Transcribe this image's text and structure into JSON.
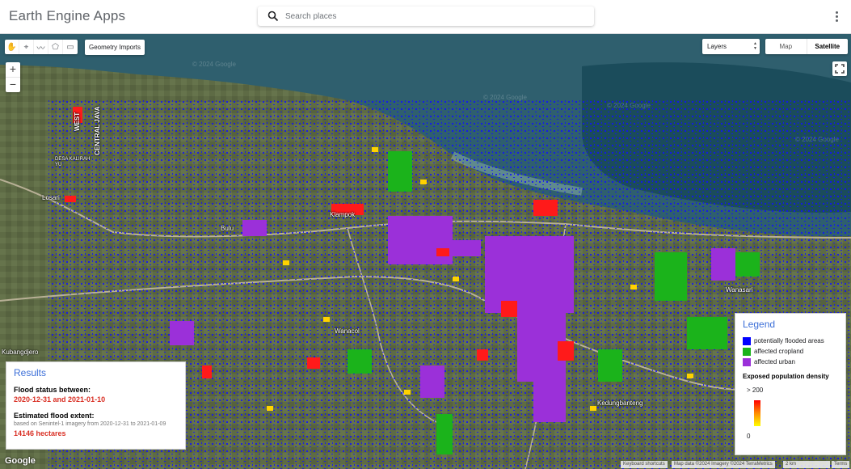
{
  "app": {
    "title": "Earth Engine Apps",
    "menu_icon": "more-vert-icon"
  },
  "search": {
    "placeholder": "Search places",
    "icon": "search-icon"
  },
  "toolbar": {
    "tools": [
      {
        "name": "pan-hand-icon",
        "glyph": "✋"
      },
      {
        "name": "point-marker-icon",
        "glyph": "⌖"
      },
      {
        "name": "line-icon",
        "glyph": "〰"
      },
      {
        "name": "polygon-icon",
        "glyph": "⬠"
      },
      {
        "name": "rectangle-icon",
        "glyph": "▭"
      }
    ],
    "geometry_imports_label": "Geometry Imports"
  },
  "zoom": {
    "in_label": "+",
    "out_label": "−"
  },
  "layers": {
    "label": "Layers"
  },
  "map_type": {
    "map_label": "Map",
    "satellite_label": "Satellite",
    "selected": "Satellite"
  },
  "places": [
    {
      "name": "place-label-desa-kalirahyu",
      "text": "DESA KALIRAH YU"
    },
    {
      "name": "place-label-losari",
      "text": "Losari"
    },
    {
      "name": "place-label-bulu",
      "text": "Bulu"
    },
    {
      "name": "place-label-klampok",
      "text": "Klampok"
    },
    {
      "name": "place-label-wanasari",
      "text": "Wanasari"
    },
    {
      "name": "place-label-wanacol",
      "text": "Wanacol"
    },
    {
      "name": "place-label-kubangdjero",
      "text": "Kubangdjero"
    },
    {
      "name": "place-label-kedungbanteng",
      "text": "Kedungbanteng"
    },
    {
      "name": "place-label-west",
      "text": "WEST"
    },
    {
      "name": "place-label-central-java",
      "text": "CENTRAL JAVA"
    }
  ],
  "watermark": "© 2024 Google",
  "results": {
    "title": "Results",
    "status_label": "Flood status between:",
    "status_range": "2020-12-31 and 2021-01-10",
    "extent_label": "Estimated flood extent:",
    "extent_note": "based on Senintel-1 imagery from 2020-12-31 to 2021-01-09",
    "extent_value": "14146 hectares"
  },
  "legend": {
    "title": "Legend",
    "items": [
      {
        "label": "potentially flooded areas",
        "color": "#0000ff"
      },
      {
        "label": "affected cropland",
        "color": "#1bb31b"
      },
      {
        "label": "affected urban",
        "color": "#9b30d9"
      }
    ],
    "population_title": "Exposed population density",
    "population_max": "> 200",
    "population_min": "0",
    "population_colors": [
      "#ff0000",
      "#ff8c00",
      "#ffff00"
    ]
  },
  "footer": {
    "google_logo": "Google",
    "keyboard_shortcuts": "Keyboard shortcuts",
    "map_data": "Map data ©2024 Imagery ©2024 TerraMetrics",
    "scale": "2 km",
    "terms": "Terms"
  }
}
